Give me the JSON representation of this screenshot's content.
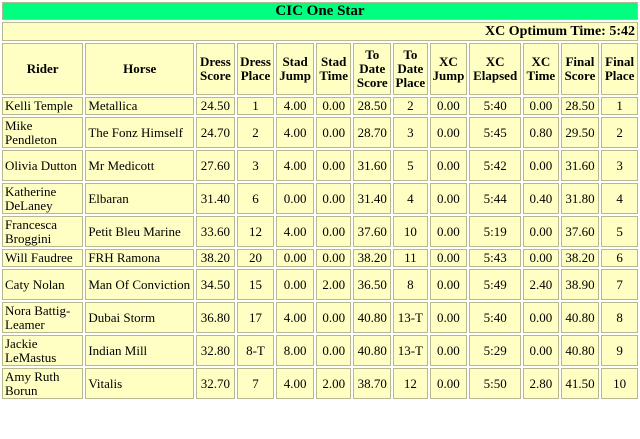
{
  "title": "CIC One Star",
  "optimum_time": "XC Optimum Time: 5:42",
  "columns": [
    "Rider",
    "Horse",
    "Dress Score",
    "Dress Place",
    "Stad Jump",
    "Stad Time",
    "To Date Score",
    "To Date Place",
    "XC Jump",
    "XC Elapsed",
    "XC Time",
    "Final Score",
    "Final Place"
  ],
  "rows": [
    [
      "Kelli Temple",
      "Metallica",
      "24.50",
      "1",
      "4.00",
      "0.00",
      "28.50",
      "2",
      "0.00",
      "5:40",
      "0.00",
      "28.50",
      "1"
    ],
    [
      "Mike Pendleton",
      "The Fonz Himself",
      "24.70",
      "2",
      "4.00",
      "0.00",
      "28.70",
      "3",
      "0.00",
      "5:45",
      "0.80",
      "29.50",
      "2"
    ],
    [
      "Olivia Dutton",
      "Mr Medicott",
      "27.60",
      "3",
      "4.00",
      "0.00",
      "31.60",
      "5",
      "0.00",
      "5:42",
      "0.00",
      "31.60",
      "3"
    ],
    [
      "Katherine DeLaney",
      "Elbaran",
      "31.40",
      "6",
      "0.00",
      "0.00",
      "31.40",
      "4",
      "0.00",
      "5:44",
      "0.40",
      "31.80",
      "4"
    ],
    [
      "Francesca Broggini",
      "Petit Bleu Marine",
      "33.60",
      "12",
      "4.00",
      "0.00",
      "37.60",
      "10",
      "0.00",
      "5:19",
      "0.00",
      "37.60",
      "5"
    ],
    [
      "Will Faudree",
      "FRH Ramona",
      "38.20",
      "20",
      "0.00",
      "0.00",
      "38.20",
      "11",
      "0.00",
      "5:43",
      "0.00",
      "38.20",
      "6"
    ],
    [
      "Caty Nolan",
      "Man Of Conviction",
      "34.50",
      "15",
      "0.00",
      "2.00",
      "36.50",
      "8",
      "0.00",
      "5:49",
      "2.40",
      "38.90",
      "7"
    ],
    [
      "Nora Battig-Leamer",
      "Dubai Storm",
      "36.80",
      "17",
      "4.00",
      "0.00",
      "40.80",
      "13-T",
      "0.00",
      "5:40",
      "0.00",
      "40.80",
      "8"
    ],
    [
      "Jackie LeMastus",
      "Indian Mill",
      "32.80",
      "8-T",
      "8.00",
      "0.00",
      "40.80",
      "13-T",
      "0.00",
      "5:29",
      "0.00",
      "40.80",
      "9"
    ],
    [
      "Amy Ruth Borun",
      "Vitalis",
      "32.70",
      "7",
      "4.00",
      "2.00",
      "38.70",
      "12",
      "0.00",
      "5:50",
      "2.80",
      "41.50",
      "10"
    ]
  ]
}
